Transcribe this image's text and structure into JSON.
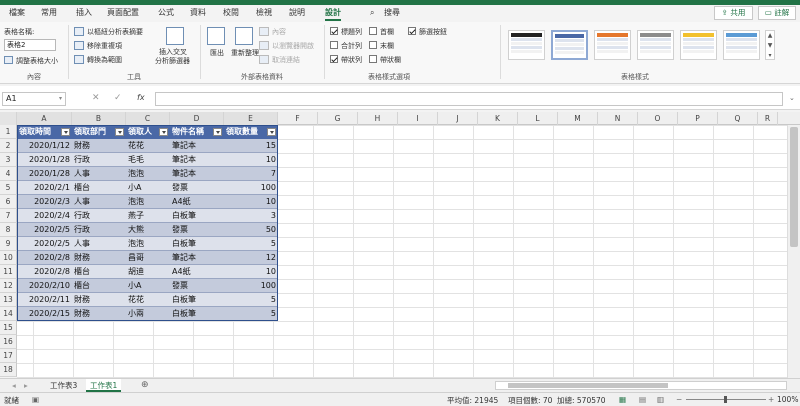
{
  "tabs": [
    "檔案",
    "常用",
    "插入",
    "頁面配置",
    "公式",
    "資料",
    "校閱",
    "檢視",
    "說明",
    "設計"
  ],
  "search_label": "搜尋",
  "share_label": "共用",
  "comment_label": "註解",
  "ribbon": {
    "properties": {
      "table_name_label": "表格名稱:",
      "table_name_value": "表格2",
      "resize_label": "調整表格大小",
      "group": "內容"
    },
    "tools": {
      "pivot": "以樞紐分析表摘要",
      "remove_dup": "移除重複項",
      "convert": "轉換為範圍",
      "slicer_l1": "插入交叉",
      "slicer_l2": "分析篩選器",
      "group": "工具"
    },
    "external": {
      "export": "匯出",
      "refresh": "重新整理",
      "properties": "內容",
      "open_browser": "以瀏覽器開啟",
      "unlink": "取消連結",
      "group": "外部表格資料"
    },
    "style_options": {
      "header_row": "標題列",
      "total_row": "合計列",
      "banded_rows": "帶狀列",
      "first_col": "首欄",
      "last_col": "末欄",
      "banded_cols": "帶狀欄",
      "filter_btn": "篩選按鈕",
      "group": "表格樣式選項"
    },
    "styles_group": "表格樣式"
  },
  "style_colors": [
    "#222222",
    "#4a68a6",
    "#e5772d",
    "#8c8c8c",
    "#f2c12e",
    "#5b9bd5"
  ],
  "namebox": "A1",
  "fx_label": "fx",
  "columns": [
    "A",
    "B",
    "C",
    "D",
    "E",
    "F",
    "G",
    "H",
    "I",
    "J",
    "K",
    "L",
    "M",
    "N",
    "O",
    "P",
    "Q",
    "R"
  ],
  "rows": [
    "1",
    "2",
    "3",
    "4",
    "5",
    "6",
    "7",
    "8",
    "9",
    "10",
    "11",
    "12",
    "13",
    "14",
    "15",
    "16",
    "17",
    "18"
  ],
  "table": {
    "headers": [
      "領取時間",
      "領取部門",
      "領取人",
      "物件名稱",
      "領取數量"
    ],
    "rows": [
      [
        "2020/1/12",
        "財務",
        "花花",
        "筆記本",
        "15"
      ],
      [
        "2020/1/28",
        "行政",
        "毛毛",
        "筆記本",
        "10"
      ],
      [
        "2020/1/28",
        "人事",
        "泡泡",
        "筆記本",
        "7"
      ],
      [
        "2020/2/1",
        "櫃台",
        "小A",
        "發票",
        "100"
      ],
      [
        "2020/2/3",
        "人事",
        "泡泡",
        "A4紙",
        "10"
      ],
      [
        "2020/2/4",
        "行政",
        "燕子",
        "白板筆",
        "3"
      ],
      [
        "2020/2/5",
        "行政",
        "大熊",
        "發票",
        "50"
      ],
      [
        "2020/2/5",
        "人事",
        "泡泡",
        "白板筆",
        "5"
      ],
      [
        "2020/2/8",
        "財務",
        "昌哥",
        "筆記本",
        "12"
      ],
      [
        "2020/2/8",
        "櫃台",
        "胡迪",
        "A4紙",
        "10"
      ],
      [
        "2020/2/10",
        "櫃台",
        "小A",
        "發票",
        "100"
      ],
      [
        "2020/2/11",
        "財務",
        "花花",
        "白板筆",
        "5"
      ],
      [
        "2020/2/15",
        "財務",
        "小兩",
        "白板筆",
        "5"
      ]
    ]
  },
  "sheets": [
    "工作表3",
    "工作表1"
  ],
  "status": {
    "ready": "就緒",
    "average": "平均值: 21945",
    "count": "項目個數: 70",
    "sum": "加總: 570570",
    "zoom": "100%"
  }
}
